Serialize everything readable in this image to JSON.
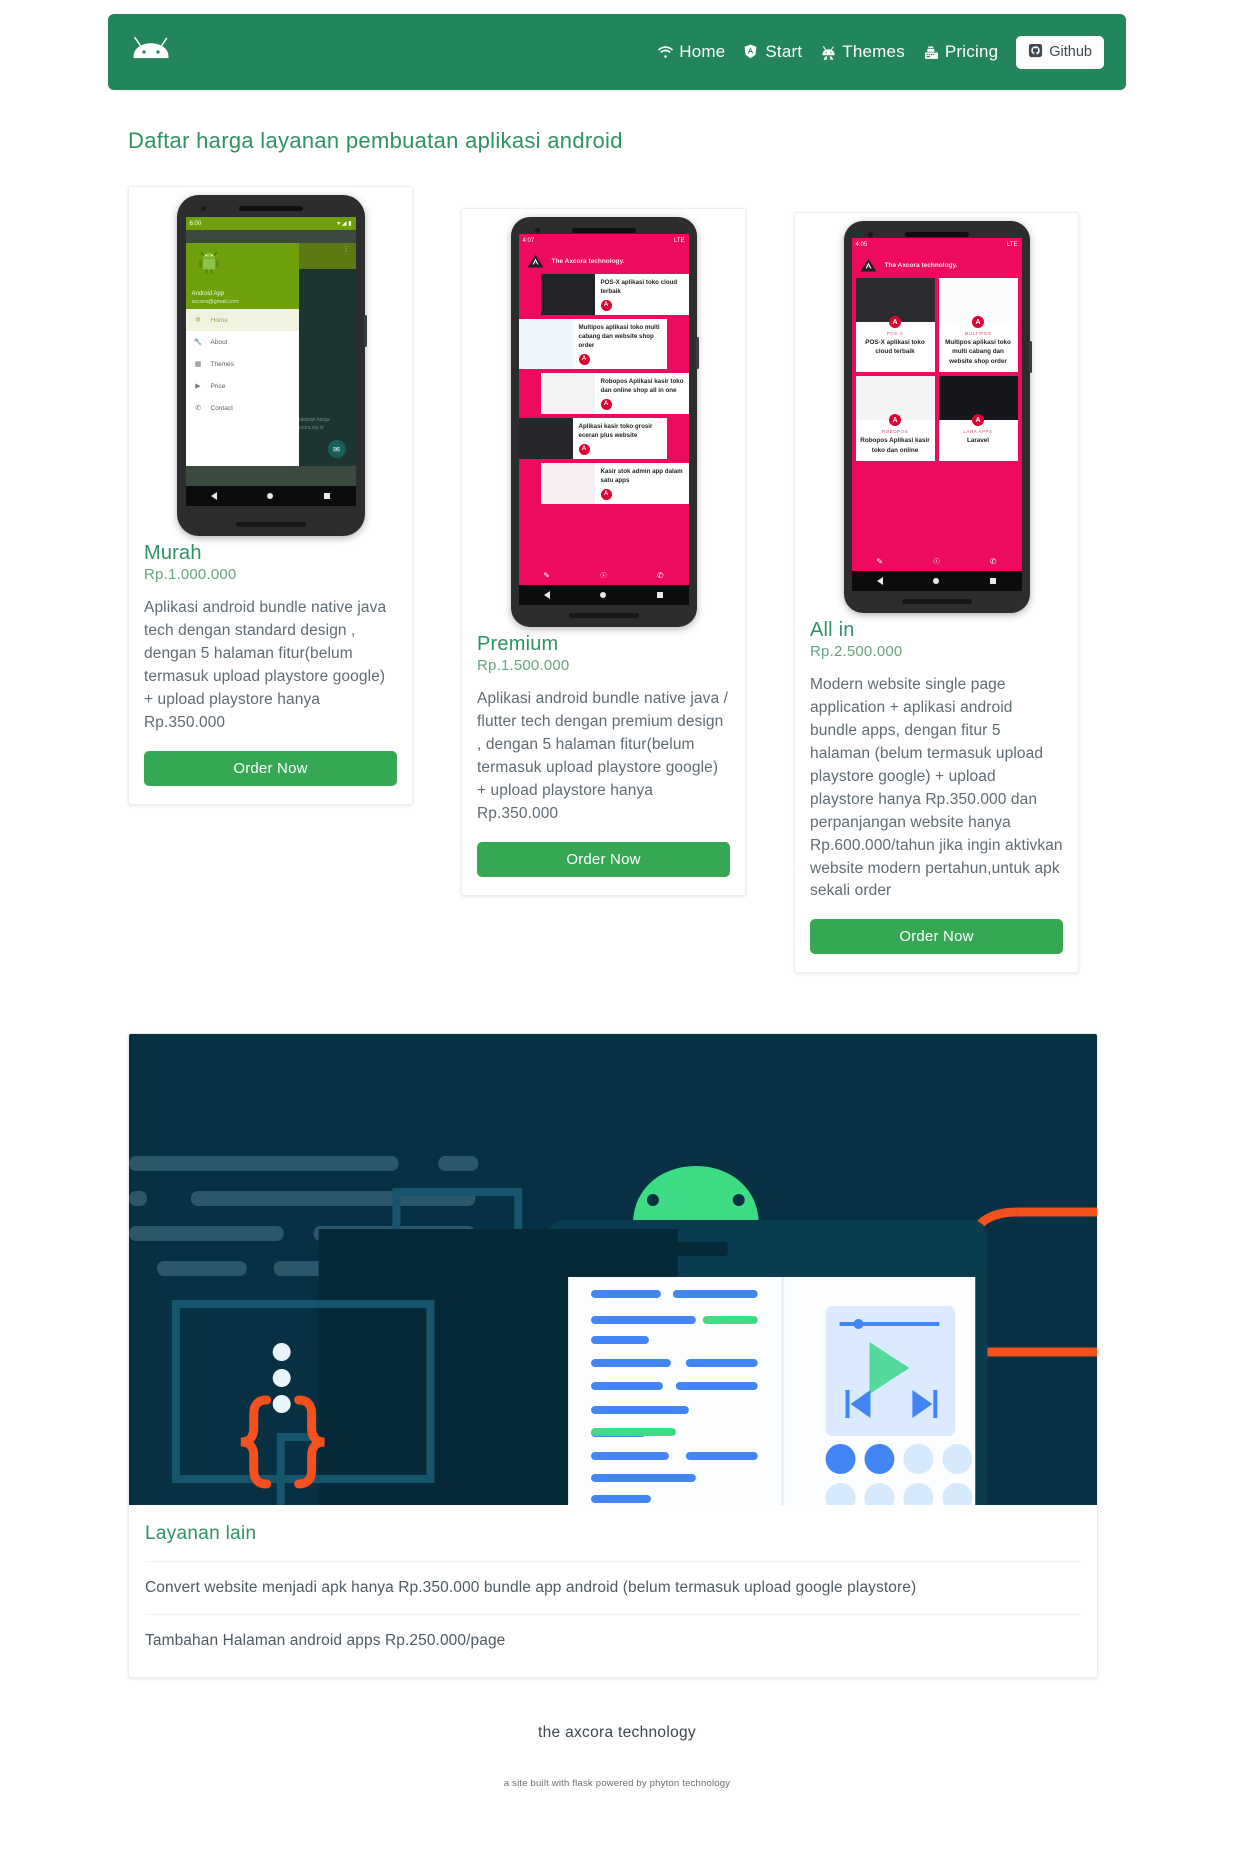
{
  "navbar": {
    "brand_icon": "android-robot-icon",
    "links": [
      {
        "label": "Home",
        "icon": "wifi-icon"
      },
      {
        "label": "Start",
        "icon": "angular-shield-icon"
      },
      {
        "label": "Themes",
        "icon": "android-head-icon"
      },
      {
        "label": "Pricing",
        "icon": "cash-register-icon"
      }
    ],
    "github_button": {
      "label": "Github",
      "icon": "github-icon"
    },
    "background_color": "#23855b"
  },
  "page_title": "Daftar harga layanan pembuatan aplikasi android",
  "plans": [
    {
      "name": "Murah",
      "price": "Rp.1.000.000",
      "description": "Aplikasi android bundle native java tech dengan standard design , dengan 5 halaman fitur(belum termasuk upload playstore google) + upload playstore hanya Rp.350.000",
      "button": "Order Now",
      "preview": {
        "type": "android-drawer",
        "status_time": "6:00",
        "app_name": "Android App",
        "app_email": "axcora@gmail.com",
        "menu": [
          "Home",
          "About",
          "Themes",
          "Price",
          "Contact"
        ],
        "body_text": "Halaman harga axcora.my.id"
      }
    },
    {
      "name": "Premium",
      "price": "Rp.1.500.000",
      "description": "Aplikasi android bundle native java / flutter tech dengan premium design , dengan 5 halaman fitur(belum termasuk upload playstore google) + upload playstore hanya Rp.350.000",
      "button": "Order Now",
      "preview": {
        "type": "android-list",
        "status_time": "4:07",
        "status_net": "LTE",
        "brand": "The Axcora technology.",
        "items": [
          "POS-X aplikasi toko cloud terbaik",
          "Multipos aplikasi toko multi cabang dan website shop order",
          "Robopos Aplikasi kasir toko dan online shop all in one",
          "Aplikasi kasir toko grosir eceran plus website",
          "Kasir stok admin app dalam satu apps"
        ]
      }
    },
    {
      "name": "All in",
      "price": "Rp.2.500.000",
      "description": "Modern website single page application + aplikasi android bundle apps, dengan fitur 5 halaman (belum termasuk upload playstore google) + upload playstore hanya Rp.350.000 dan perpanjangan website hanya Rp.600.000/tahun jika ingin aktivkan website modern pertahun,untuk apk sekali order",
      "button": "Order Now",
      "preview": {
        "type": "android-grid",
        "status_time": "4:05",
        "status_net": "LTE",
        "brand": "The Axcora technology.",
        "cells": [
          {
            "kicker": "POS-X",
            "title": "POS-X aplikasi toko cloud terbaik"
          },
          {
            "kicker": "MULTIPOS",
            "title": "Multipos aplikasi toko multi cabang dan website shop order"
          },
          {
            "kicker": "ROBOPOS",
            "title": "Robopos Aplikasi kasir toko dan online"
          },
          {
            "kicker": "LARA APPS",
            "title": "Laravel"
          }
        ]
      }
    }
  ],
  "other_services": {
    "title": "Layanan lain",
    "illustration": "android-developer-illustration",
    "rows": [
      "Convert website menjadi apk hanya Rp.350.000 bundle app android (belum termasuk upload google playstore)",
      "Tambahan Halaman android apps Rp.250.000/page"
    ]
  },
  "footer": {
    "main": "the axcora technology",
    "sub": "a site built with flask powered by phyton technology"
  },
  "colors": {
    "brand_green": "#23855b",
    "accent_green": "#2f9265",
    "button_green": "#36a853",
    "pink": "#ee0a5f",
    "hero_navy": "#073042",
    "hero_orange": "#f4511e"
  }
}
